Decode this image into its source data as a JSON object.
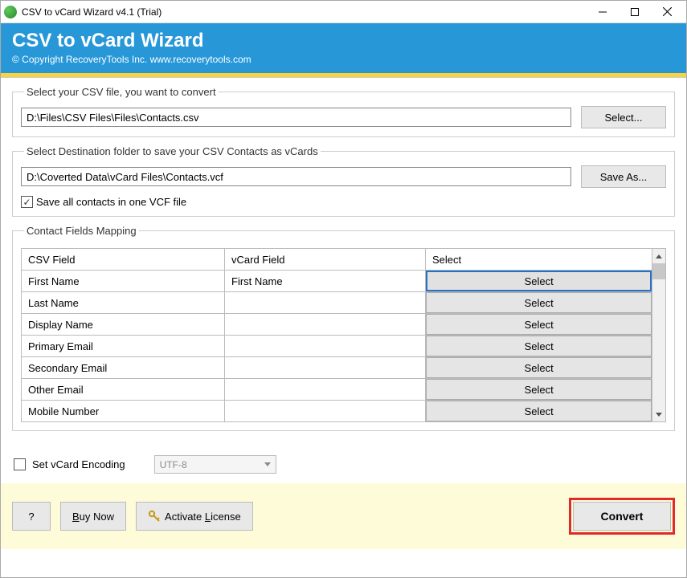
{
  "window": {
    "title": "CSV to vCard Wizard v4.1 (Trial)"
  },
  "header": {
    "title": "CSV to vCard Wizard",
    "subtitle": "© Copyright RecoveryTools Inc. www.recoverytools.com"
  },
  "source": {
    "legend": "Select your CSV file, you want to convert",
    "path": "D:\\Files\\CSV Files\\Files\\Contacts.csv",
    "button": "Select..."
  },
  "dest": {
    "legend": "Select Destination folder to save your CSV Contacts as vCards",
    "path": "D:\\Coverted Data\\vCard Files\\Contacts.vcf",
    "button": "Save As...",
    "save_all_label": "Save all contacts in one VCF file"
  },
  "mapping": {
    "legend": "Contact Fields Mapping",
    "headers": {
      "csv": "CSV Field",
      "vcard": "vCard Field",
      "select": "Select"
    },
    "select_label": "Select",
    "rows": [
      {
        "csv": "First Name",
        "vcard": "First Name",
        "highlighted": true
      },
      {
        "csv": "Last Name",
        "vcard": ""
      },
      {
        "csv": "Display Name",
        "vcard": ""
      },
      {
        "csv": "Primary Email",
        "vcard": ""
      },
      {
        "csv": "Secondary Email",
        "vcard": ""
      },
      {
        "csv": "Other Email",
        "vcard": ""
      },
      {
        "csv": "Mobile Number",
        "vcard": ""
      }
    ]
  },
  "encoding": {
    "label": "Set vCard Encoding",
    "value": "UTF-8"
  },
  "footer": {
    "help": "?",
    "buy": "Buy Now",
    "activate": "Activate License",
    "convert": "Convert"
  }
}
